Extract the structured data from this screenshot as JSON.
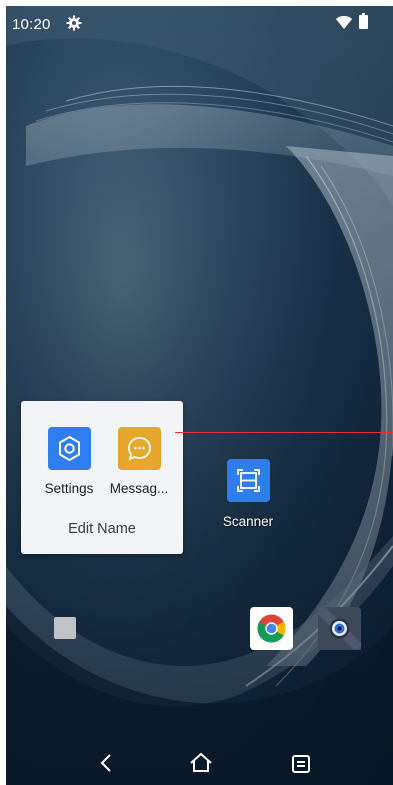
{
  "status_bar": {
    "time": "10:20",
    "icons": [
      "gear-icon",
      "wifi-icon",
      "battery-icon"
    ]
  },
  "folder": {
    "apps": [
      {
        "label": "Settings",
        "icon": "gear-icon",
        "color": "#2f7ef1"
      },
      {
        "label": "Messag...",
        "icon": "chat-bubble-icon",
        "color": "#e7a72c"
      }
    ],
    "edit_name_label": "Edit Name"
  },
  "home_apps": [
    {
      "label": "Scanner",
      "icon": "scan-frame-icon",
      "color": "#2f7ef1"
    }
  ],
  "dock": [
    "blank-square-icon",
    "chrome-icon",
    "camera-icon"
  ],
  "nav_bar": [
    "back-icon",
    "home-icon",
    "recents-icon"
  ],
  "colors": {
    "accent_blue": "#2f7ef1",
    "accent_orange": "#e7a72c",
    "guide_line_red": "#e0303a"
  }
}
